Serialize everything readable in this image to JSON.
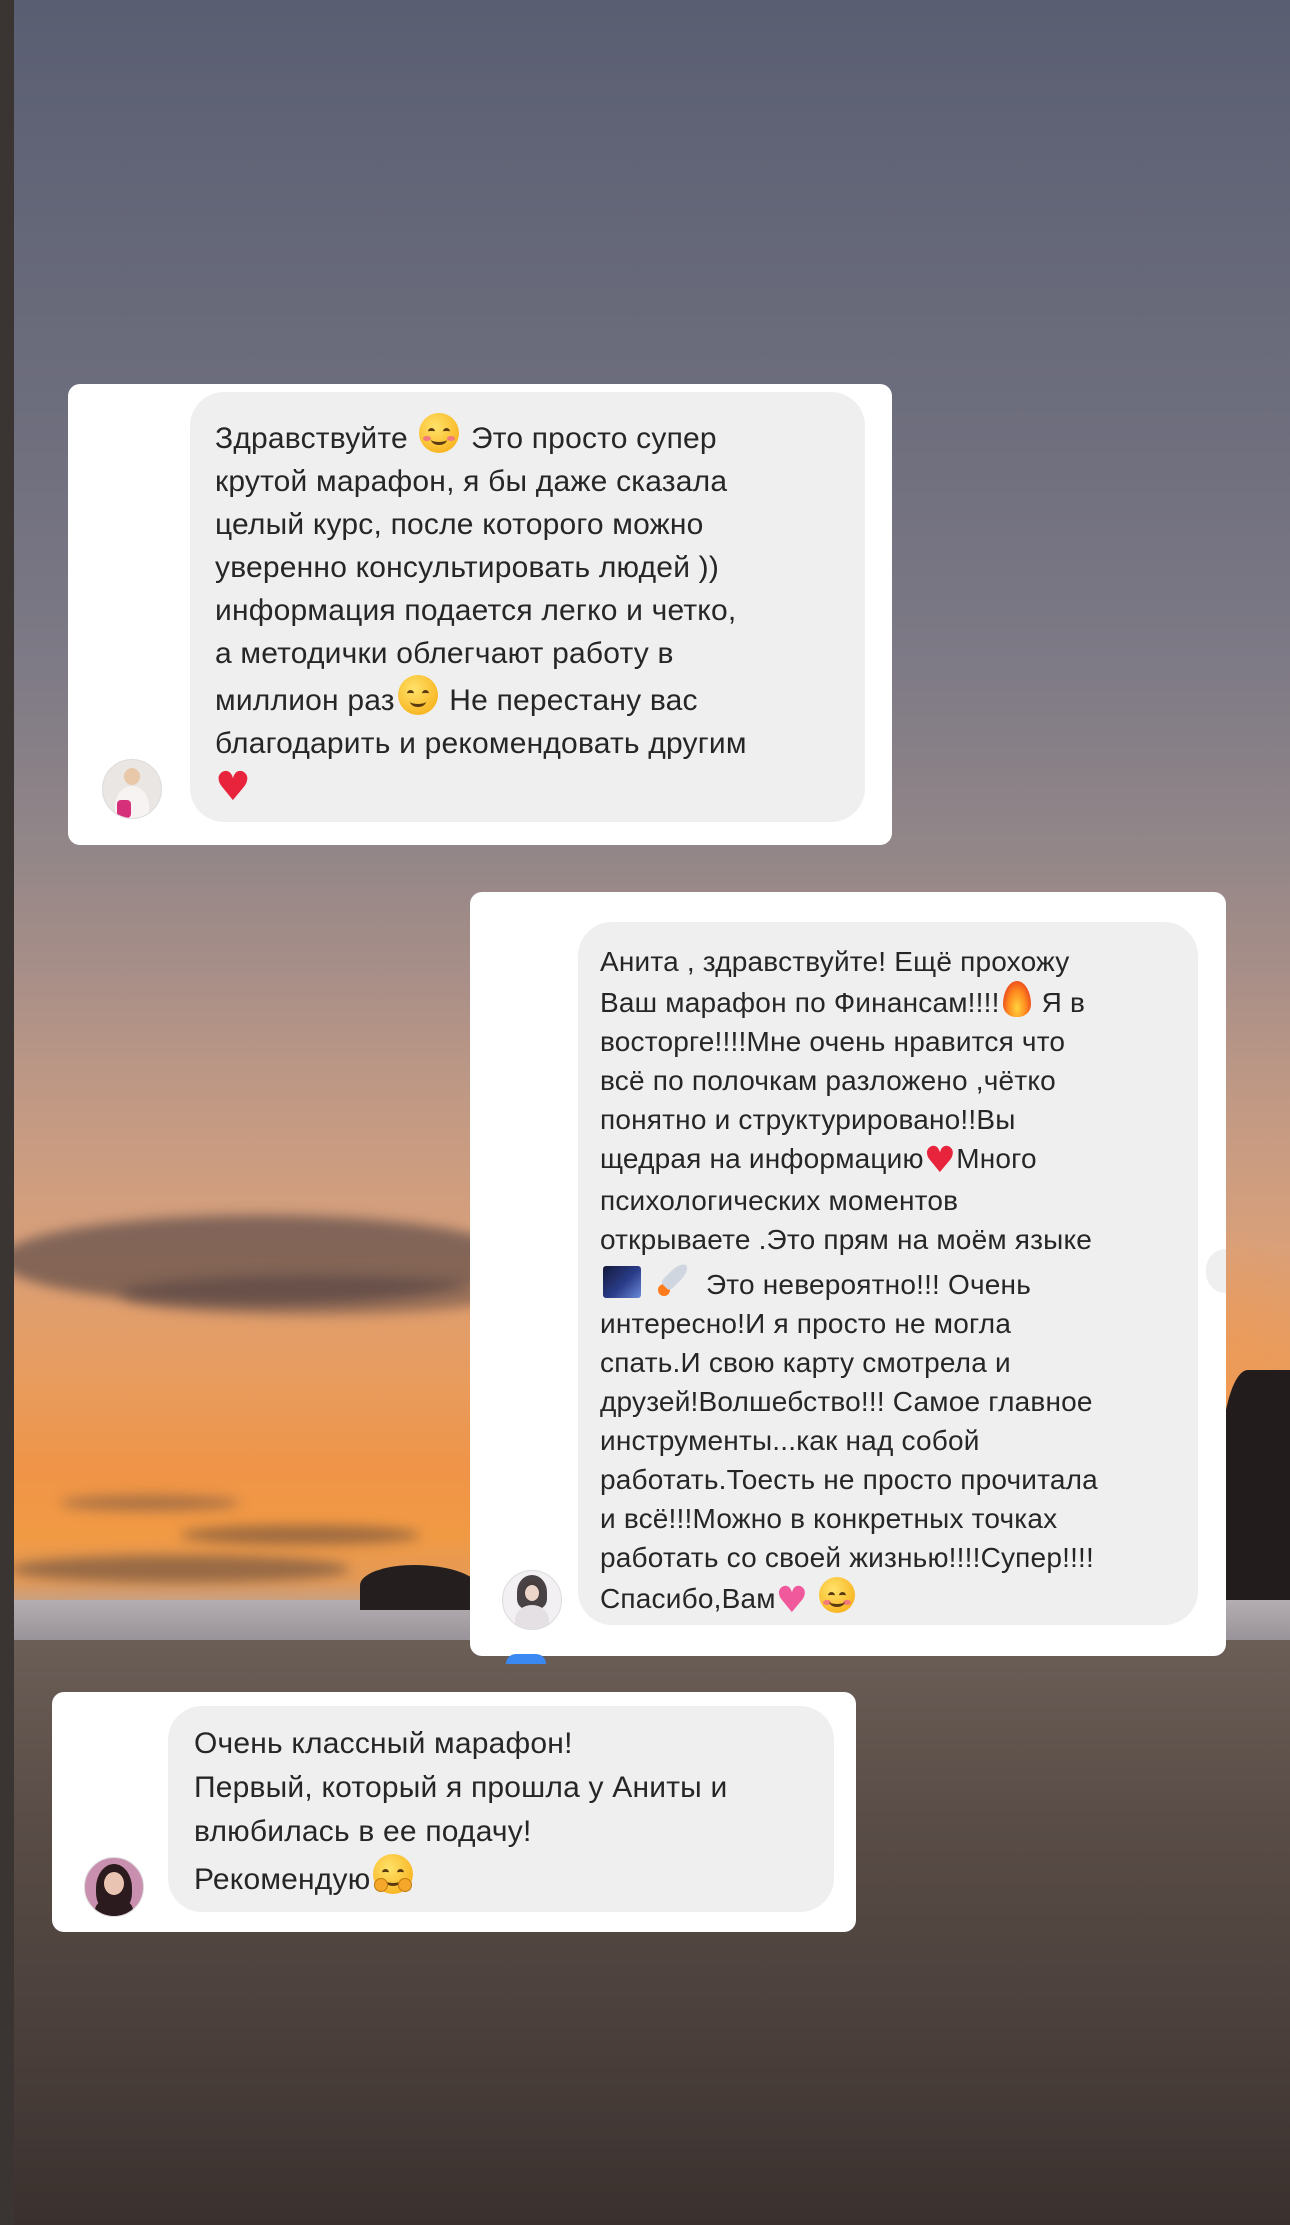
{
  "messages": [
    {
      "lines": [
        "Здравствуйте",
        "крутой марафон, я бы даже сказала",
        "целый курс, после которого можно",
        "уверенно консультировать людей ))",
        "информация подается легко и четко,",
        "а методички облегчают работу в",
        "миллион раз",
        "благодарить и рекомендовать другим"
      ],
      "line0_tail": "Это просто супер",
      "line6_tail": "Не перестану вас",
      "emojis": [
        "smiling-face-with-hearts",
        "smiling-face",
        "red-heart"
      ]
    },
    {
      "lines": [
        "Анита , здравствуйте! Ещё прохожу",
        "Ваш марафон по Финансам!!!!",
        "Я в",
        "восторге!!!!Мне очень нравится что",
        "всё по полочкам разложено ,чётко",
        "понятно и структурировано!!Вы",
        "щедрая на информацию",
        "Много",
        "психологических моментов",
        "открываете .Это прям на моём языке",
        "Это невероятно!!! Очень",
        "интересно!И я просто не могла",
        "спать.И свою карту смотрела и",
        "друзей!Волшебство!!! Самое главное",
        "инструменты...как над собой",
        "работать.Тоесть не просто прочитала",
        "и всё!!!Можно в конкретных точках",
        "работать со своей жизнью!!!!Супер!!!!",
        "Спасибо,Вам"
      ],
      "emojis": [
        "fire",
        "red-heart",
        "milky-way",
        "rocket",
        "sparkling-heart",
        "smiling-face-with-hearts"
      ]
    },
    {
      "lines": [
        "Очень классный марафон!",
        "Первый, который я прошла у Аниты и",
        "влюбилась в ее подачу!",
        "Рекомендую"
      ],
      "emojis": [
        "hugging-face"
      ]
    }
  ],
  "colors": {
    "bubble": "#efefef",
    "card": "#ffffff",
    "text": "#262626"
  }
}
